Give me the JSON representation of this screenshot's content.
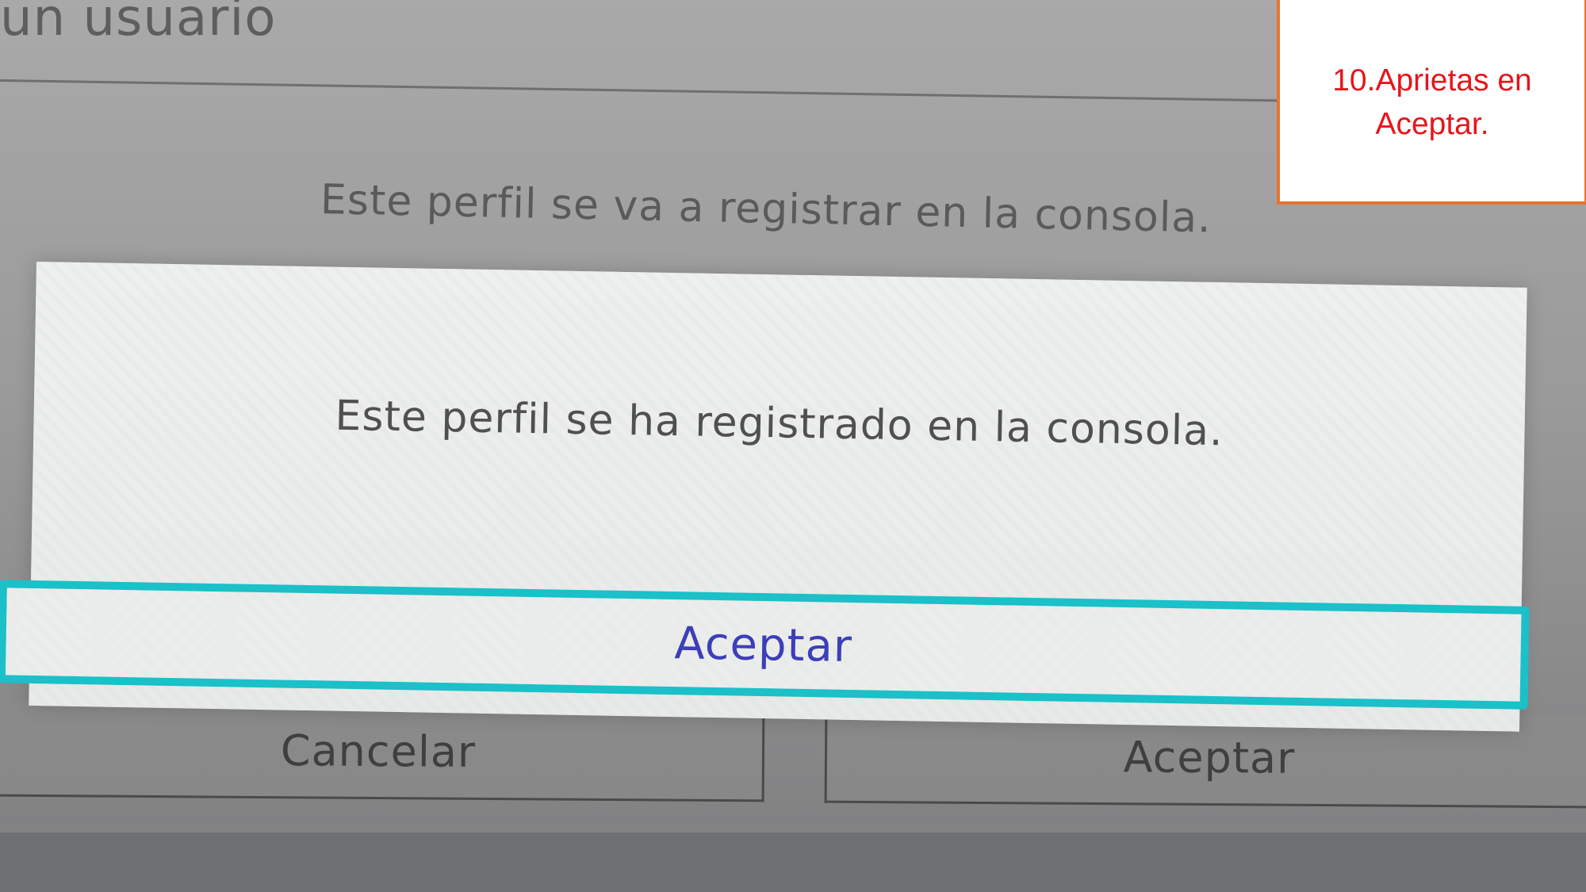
{
  "background": {
    "title": "un usuario",
    "message": "Este perfil se va a registrar en la consola.",
    "buttons": {
      "cancel_label": "Cancelar",
      "accept_label": "Aceptar"
    }
  },
  "dialog": {
    "message": "Este perfil se ha registrado en la consola.",
    "accept_label": "Aceptar"
  },
  "annotation": {
    "text": "10.Aprietas en Aceptar."
  },
  "colors": {
    "focus_highlight": "#1bc0c8",
    "dialog_button_text": "#3c3fb8",
    "annotation_text": "#e8141b",
    "annotation_border": "#e8742e"
  }
}
